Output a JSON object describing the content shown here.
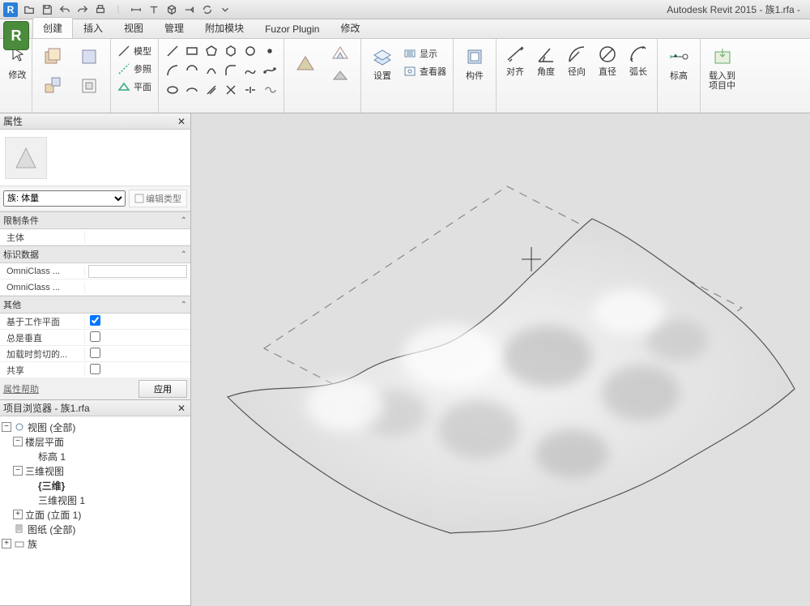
{
  "title": "Autodesk Revit 2015 -     族1.rfa -",
  "app_icon": "R",
  "tabs": {
    "create": "创建",
    "insert": "插入",
    "view": "视图",
    "manage": "管理",
    "addins": "附加模块",
    "fuzor": "Fuzor Plugin",
    "modify": "修改"
  },
  "ribbon": {
    "modify_label": "修改",
    "model_label": "模型",
    "ref_label": "参照",
    "plane_label": "平面",
    "settings": "设置",
    "show": "显示",
    "viewer": "查看器",
    "component": "构件",
    "align": "对齐",
    "angle": "角度",
    "radial": "径向",
    "diameter": "直径",
    "arc": "弧长",
    "level": "标高",
    "load": "载入到\n项目中"
  },
  "properties": {
    "title": "属性",
    "type_label": "族: 体量",
    "edit_type": "编辑类型",
    "sec_constraints": "限制条件",
    "host": "主体",
    "sec_identity": "标识数据",
    "omni1": "OmniClass ...",
    "omni2": "OmniClass ...",
    "sec_other": "其他",
    "workplane": "基于工作平面",
    "vertical": "总是垂直",
    "cutload": "加载时剪切的...",
    "shared": "共享",
    "help": "属性帮助",
    "apply": "应用"
  },
  "browser": {
    "title": "项目浏览器 - 族1.rfa",
    "views": "视图 (全部)",
    "floorplan": "楼层平面",
    "level1": "标高 1",
    "view3d": "三维视图",
    "threed": "{三维}",
    "threed1": "三维视图 1",
    "elevation": "立面 (立面 1)",
    "sheets": "图纸 (全部)",
    "families": "族"
  }
}
